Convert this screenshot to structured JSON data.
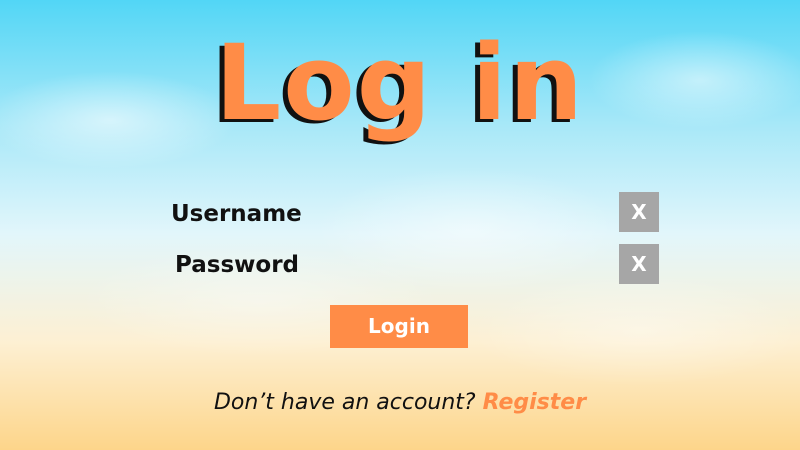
{
  "title": "Log in",
  "form": {
    "username_label": "Username",
    "username_value": "",
    "password_label": "Password",
    "password_value": "",
    "clear_label": "X",
    "login_label": "Login"
  },
  "footer": {
    "prompt": "Don’t have an account?",
    "register_label": "Register"
  },
  "colors": {
    "accent": "#ff8c47",
    "clear_button": "#a6a6a6",
    "text": "#111111"
  }
}
